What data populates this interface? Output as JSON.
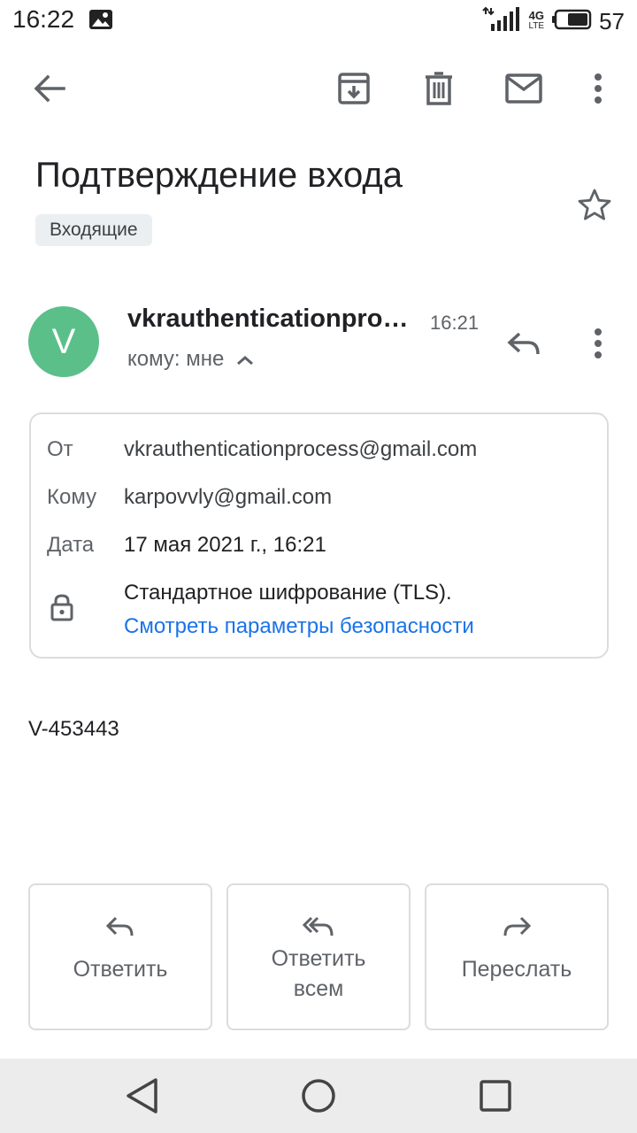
{
  "status_bar": {
    "time": "16:22",
    "network": "4G",
    "network_sub": "LTE",
    "battery": "57",
    "icons": [
      "gallery-icon",
      "signal-icon",
      "battery-icon"
    ]
  },
  "toolbar": {
    "icons": [
      "back-arrow-icon",
      "archive-icon",
      "trash-icon",
      "mail-icon",
      "more-vert-icon"
    ]
  },
  "email": {
    "subject": "Подтверждение входа",
    "label": "Входящие",
    "sender": {
      "avatar_letter": "V",
      "avatar_color": "#5bbf8a",
      "name": "vkrauthenticationprocess@gmail.com",
      "time": "16:21",
      "recipient_line": "кому: мне"
    },
    "details": {
      "from_label": "От",
      "from_value": "vkrauthenticationprocess@gmail.com",
      "to_label": "Кому",
      "to_value": "karpovvly@gmail.com",
      "date_label": "Дата",
      "date_value": "17 мая 2021 г., 16:21",
      "security_text": "Стандартное шифрование (TLS).",
      "security_link": "Смотреть параметры безопасности"
    },
    "body": "V-453443"
  },
  "actions": {
    "reply": "Ответить",
    "reply_all_line1": "Ответить",
    "reply_all_line2": "всем",
    "forward": "Переслать"
  },
  "colors": {
    "accent_link": "#1a73e8",
    "nav_bar": "#ececec"
  }
}
